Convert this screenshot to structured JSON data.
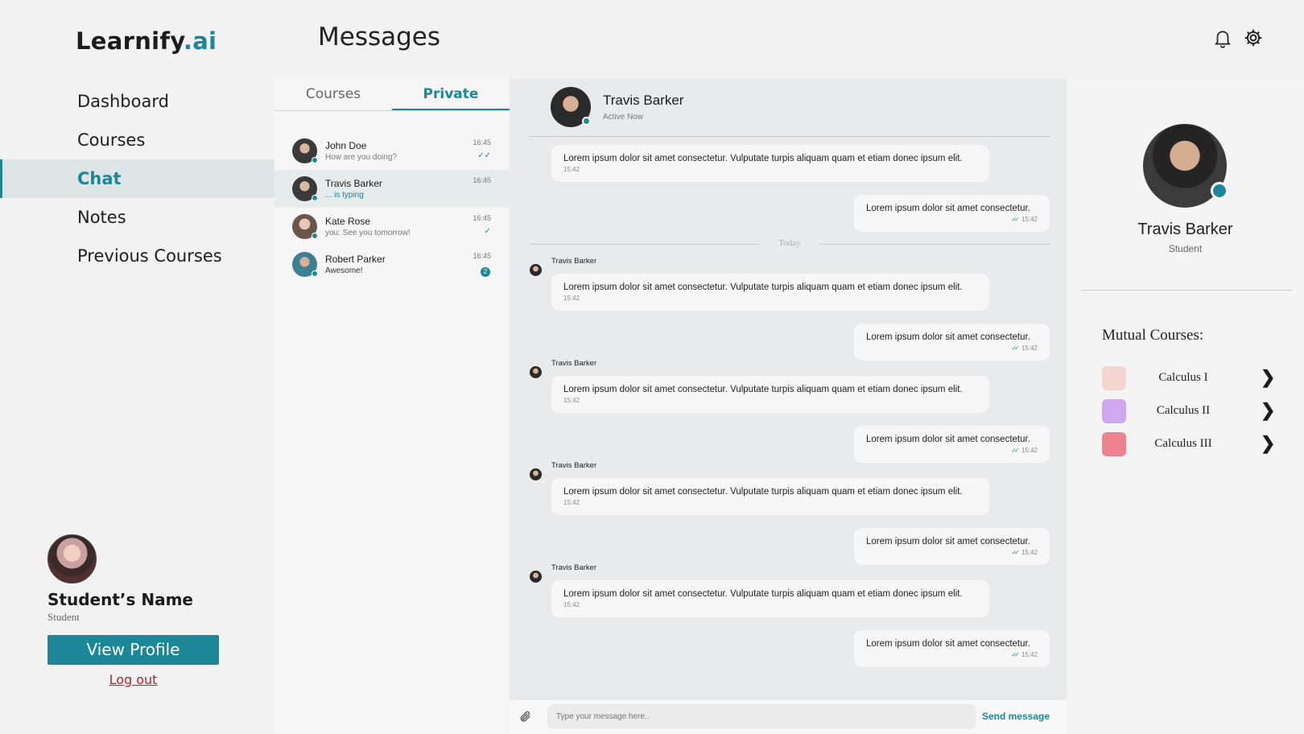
{
  "app": {
    "logo_main": "Learnify",
    "logo_suffix": ".ai",
    "accent_color": "#1b8799"
  },
  "sidebar": {
    "items": [
      {
        "label": "Dashboard"
      },
      {
        "label": "Courses"
      },
      {
        "label": "Chat"
      },
      {
        "label": "Notes"
      },
      {
        "label": "Previous Courses"
      }
    ],
    "active": "Chat"
  },
  "user": {
    "name": "Student’s Name",
    "role": "Student",
    "view_profile_label": "View Profile",
    "logout_label": "Log out"
  },
  "header": {
    "title": "Messages",
    "icons": [
      "bell-icon",
      "gear-icon"
    ]
  },
  "conversation_tabs": {
    "tabs": [
      {
        "label": "Courses"
      },
      {
        "label": "Private"
      }
    ],
    "active": "Private"
  },
  "conversations": [
    {
      "name": "John Doe",
      "preview": "How are you doing?",
      "time": "16:45",
      "status": "✓✓"
    },
    {
      "name": "Travis Barker",
      "preview": "... is typing",
      "time": "16:45",
      "status": ""
    },
    {
      "name": "Kate Rose",
      "preview": "you: See you tomorrow!",
      "time": "16:45",
      "status": "✓"
    },
    {
      "name": "Robert Parker",
      "preview": "Awesome!",
      "time": "16:45",
      "badge": "2"
    }
  ],
  "chat": {
    "contact_name": "Travis Barker",
    "contact_status": "Active Now",
    "day_divider": "Today",
    "sender_label": "Travis Barker",
    "incoming_text": "Lorem ipsum dolor sit amet consectetur. Vulputate turpis aliquam quam et etiam donec ipsum elit.",
    "outgoing_text": "Lorem ipsum dolor sit amet consectetur.",
    "message_time": "15:42",
    "input_placeholder": "Type your message here..",
    "send_label": "Send message"
  },
  "profile_panel": {
    "name": "Travis Barker",
    "role": "Student",
    "mutual_title": "Mutual Courses:",
    "courses": [
      {
        "name": "Calculus I",
        "color": "#f2d6cf"
      },
      {
        "name": "Calculus II",
        "color": "#cfa8ef"
      },
      {
        "name": "Calculus III",
        "color": "#ee8390"
      }
    ]
  }
}
